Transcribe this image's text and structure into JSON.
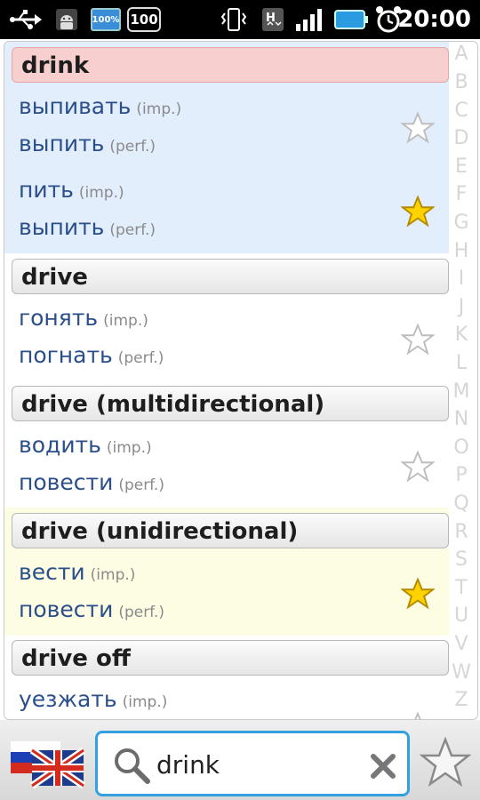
{
  "status_bar": {
    "time": "20:00",
    "battery_percent_badge": "100%",
    "level_badge": "100",
    "icons": [
      "usb-icon",
      "android-debug-icon",
      "battery-percent-icon",
      "level-badge-icon",
      "vibrate-icon",
      "data-transfer-icon",
      "signal-icon",
      "battery-icon",
      "alarm-icon"
    ]
  },
  "entries": [
    {
      "headword": "drink",
      "highlight": "pink",
      "groups": [
        {
          "words": [
            {
              "text": "выпивать",
              "aspect": "(imp.)"
            },
            {
              "text": "выпить",
              "aspect": "(perf.)"
            }
          ],
          "favorite": false
        },
        {
          "words": [
            {
              "text": "пить",
              "aspect": "(imp.)"
            },
            {
              "text": "выпить",
              "aspect": "(perf.)"
            }
          ],
          "favorite": true
        }
      ]
    },
    {
      "headword": "drive",
      "groups": [
        {
          "words": [
            {
              "text": "гонять",
              "aspect": "(imp.)"
            },
            {
              "text": "погнать",
              "aspect": "(perf.)"
            }
          ],
          "favorite": false
        }
      ]
    },
    {
      "headword": "drive (multidirectional)",
      "groups": [
        {
          "words": [
            {
              "text": "водить",
              "aspect": "(imp.)"
            },
            {
              "text": "повести",
              "aspect": "(perf.)"
            }
          ],
          "favorite": false
        }
      ]
    },
    {
      "headword": "drive (unidirectional)",
      "groups": [
        {
          "words": [
            {
              "text": "вести",
              "aspect": "(imp.)"
            },
            {
              "text": "повести",
              "aspect": "(perf.)"
            }
          ],
          "favorite": true
        }
      ]
    },
    {
      "headword": "drive off",
      "groups": [
        {
          "words": [
            {
              "text": "уезжать",
              "aspect": "(imp.)"
            }
          ],
          "favorite": false
        }
      ]
    }
  ],
  "alphabet_index": [
    "A",
    "B",
    "C",
    "D",
    "E",
    "F",
    "G",
    "H",
    "I",
    "J",
    "K",
    "L",
    "M",
    "N",
    "O",
    "P",
    "Q",
    "R",
    "S",
    "T",
    "U",
    "V",
    "W",
    "Z"
  ],
  "search": {
    "value": "drink",
    "language_direction": "ru-en"
  },
  "colors": {
    "selected_entry_bg": "#e3eefc",
    "favorite_entry_bg": "#fdfde3",
    "selected_header_bg": "#f8cfcf",
    "accent": "#33a0e0",
    "word_text": "#2b4f8a",
    "star_filled": "#ffd200"
  }
}
